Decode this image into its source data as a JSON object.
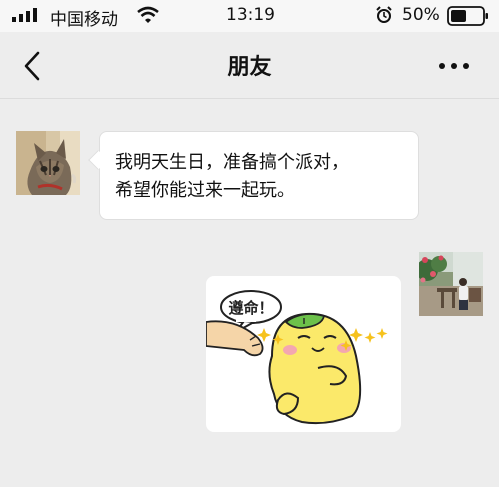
{
  "status_bar": {
    "carrier": "中国移动",
    "time": "13:19",
    "battery": "50%",
    "battery_level": 0.5
  },
  "nav": {
    "title": "朋友",
    "back_icon": "chevron-left-icon",
    "more_icon": "more-dots-icon"
  },
  "messages": [
    {
      "side": "left",
      "type": "text",
      "text_line1": "我明天生日，准备搞个派对，",
      "text_line2": "希望你能过来一起玩。"
    },
    {
      "side": "right",
      "type": "sticker",
      "sticker_caption": "遵命！"
    }
  ],
  "colors": {
    "background": "#ededed",
    "status_bar": "#f7f7f7",
    "bubble": "#ffffff",
    "sticker_character": "#fbe96a"
  }
}
